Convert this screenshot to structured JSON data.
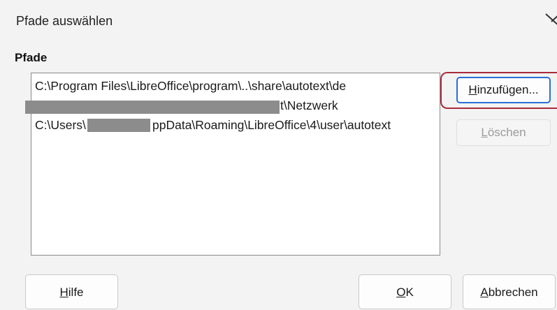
{
  "dialog": {
    "title": "Pfade auswählen",
    "section_label": "Pfade"
  },
  "paths": [
    {
      "text": "C:\\Program Files\\LibreOffice\\program\\..\\share\\autotext\\de"
    },
    {
      "visible_suffix": "t\\Netzwerk"
    },
    {
      "prefix": "C:\\Users\\",
      "suffix": "ppData\\Roaming\\LibreOffice\\4\\user\\autotext"
    }
  ],
  "buttons": {
    "add": {
      "mnemonic": "H",
      "rest": "inzufügen..."
    },
    "delete": {
      "mnemonic": "L",
      "rest": "öschen"
    },
    "help": {
      "mnemonic": "H",
      "rest": "ilfe"
    },
    "ok": {
      "mnemonic": "O",
      "rest": "K"
    },
    "cancel": {
      "mnemonic": "A",
      "rest": "bbrechen"
    }
  },
  "colors": {
    "highlight": "#a82b3b",
    "focus": "#2a6fd8"
  }
}
